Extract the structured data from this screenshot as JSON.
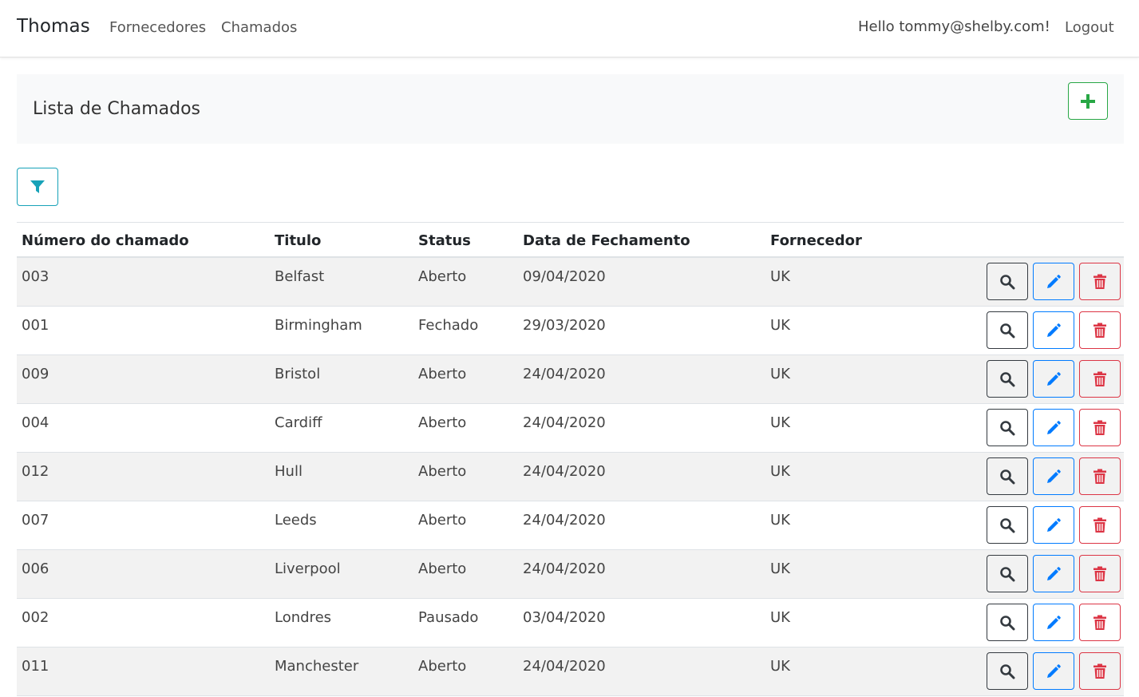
{
  "navbar": {
    "brand": "Thomas",
    "links": [
      "Fornecedores",
      "Chamados"
    ],
    "hello": "Hello tommy@shelby.com!",
    "logout": "Logout"
  },
  "header": {
    "title": "Lista de Chamados",
    "add_icon": "plus-icon"
  },
  "filter": {
    "icon": "filter-icon"
  },
  "table": {
    "columns": [
      "Número do chamado",
      "Titulo",
      "Status",
      "Data de Fechamento",
      "Fornecedor"
    ],
    "rows": [
      {
        "numero": "003",
        "titulo": "Belfast",
        "status": "Aberto",
        "data": "09/04/2020",
        "fornecedor": "UK"
      },
      {
        "numero": "001",
        "titulo": "Birmingham",
        "status": "Fechado",
        "data": "29/03/2020",
        "fornecedor": "UK"
      },
      {
        "numero": "009",
        "titulo": "Bristol",
        "status": "Aberto",
        "data": "24/04/2020",
        "fornecedor": "UK"
      },
      {
        "numero": "004",
        "titulo": "Cardiff",
        "status": "Aberto",
        "data": "24/04/2020",
        "fornecedor": "UK"
      },
      {
        "numero": "012",
        "titulo": "Hull",
        "status": "Aberto",
        "data": "24/04/2020",
        "fornecedor": "UK"
      },
      {
        "numero": "007",
        "titulo": "Leeds",
        "status": "Aberto",
        "data": "24/04/2020",
        "fornecedor": "UK"
      },
      {
        "numero": "006",
        "titulo": "Liverpool",
        "status": "Aberto",
        "data": "24/04/2020",
        "fornecedor": "UK"
      },
      {
        "numero": "002",
        "titulo": "Londres",
        "status": "Pausado",
        "data": "03/04/2020",
        "fornecedor": "UK"
      },
      {
        "numero": "011",
        "titulo": "Manchester",
        "status": "Aberto",
        "data": "24/04/2020",
        "fornecedor": "UK"
      }
    ],
    "action_icons": [
      "search-icon",
      "pencil-icon",
      "trash-icon"
    ]
  },
  "colors": {
    "success": "#28a745",
    "info": "#17a2b8",
    "primary": "#007bff",
    "danger": "#dc3545",
    "dark": "#343a40",
    "stripe": "#f2f2f2",
    "header_bg": "#f8f9fa"
  }
}
